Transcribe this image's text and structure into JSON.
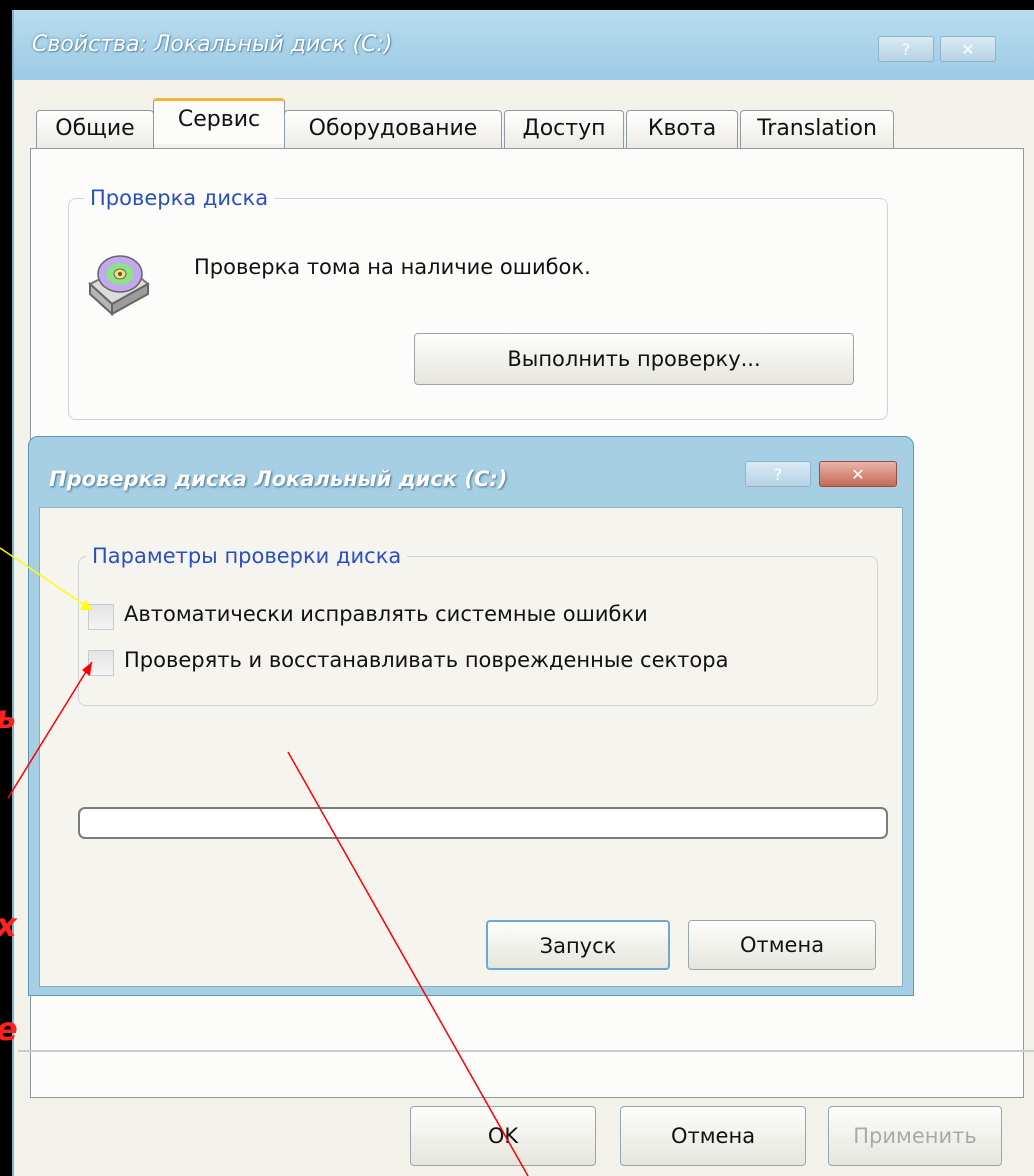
{
  "window": {
    "title": "Свойства: Локальный диск (C:)",
    "help_btn": "?",
    "close_btn": "✕"
  },
  "tabs": [
    {
      "label": "Общие"
    },
    {
      "label": "Сервис"
    },
    {
      "label": "Оборудование"
    },
    {
      "label": "Доступ"
    },
    {
      "label": "Квота"
    },
    {
      "label": "Translation"
    }
  ],
  "active_tab": "Сервис",
  "check_group": {
    "label": "Проверка диска",
    "description": "Проверка тома на наличие ошибок.",
    "run_button": "Выполнить проверку...",
    "icon": "disk-check-icon"
  },
  "dialog": {
    "title": "Проверка диска Локальный диск (C:)",
    "help_btn": "?",
    "close_btn": "✕",
    "options_group_label": "Параметры проверки диска",
    "options": [
      {
        "label": "Автоматически исправлять системные ошибки",
        "checked": false
      },
      {
        "label": "Проверять и восстанавливать поврежденные сектора",
        "checked": false
      }
    ],
    "progress": 0,
    "start_button": "Запуск",
    "cancel_button": "Отмена"
  },
  "footer": {
    "ok_button": "OK",
    "cancel_button": "Отмена",
    "apply_button": "Применить"
  },
  "annotations": {
    "fragments": [
      "ь",
      "х",
      "е"
    ],
    "colors": {
      "text": "#ff2020",
      "arrow_red": "#ff0000",
      "arrow_yellow": "#ffff00"
    }
  }
}
